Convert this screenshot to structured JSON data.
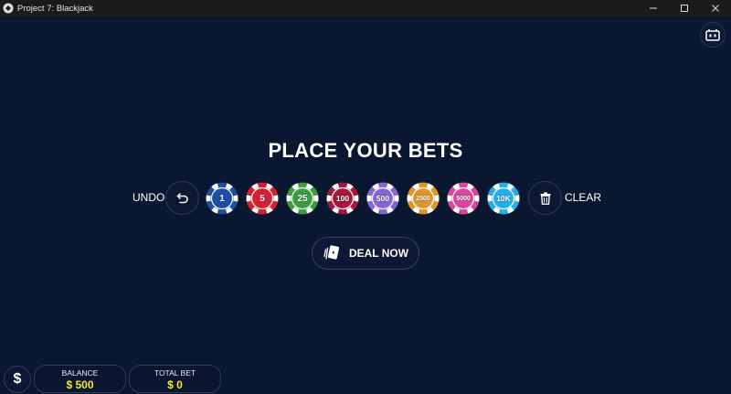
{
  "window": {
    "title": "Project 7: Blackjack",
    "minimize_icon": "minimize-icon",
    "maximize_icon": "maximize-icon",
    "close_icon": "close-icon"
  },
  "top_right_button": {
    "icon": "card-deck-icon"
  },
  "heading": "PLACE YOUR BETS",
  "undo": {
    "label": "UNDO",
    "icon": "undo-arrow-icon"
  },
  "clear": {
    "label": "CLEAR",
    "icon": "trash-icon"
  },
  "chips": [
    {
      "label": "1",
      "color": "#1e4fa3"
    },
    {
      "label": "5",
      "color": "#d42033"
    },
    {
      "label": "25",
      "color": "#3e9b3e"
    },
    {
      "label": "100",
      "color": "#a3193d"
    },
    {
      "label": "500",
      "color": "#8466d0"
    },
    {
      "label": "2500",
      "color": "#df962f"
    },
    {
      "label": "5000",
      "color": "#d6489e"
    },
    {
      "label": "10K",
      "color": "#27aee8"
    }
  ],
  "deal_button": {
    "label": "DEAL NOW",
    "icon": "cards-icon"
  },
  "bottom": {
    "dollar_icon": "dollar-icon",
    "dollar_symbol": "$",
    "balance_label": "BALANCE",
    "balance_value": "$ 500",
    "total_bet_label": "TOTAL BET",
    "total_bet_value": "$ 0"
  },
  "colors": {
    "background": "#0a1731",
    "value_yellow": "#f5e630"
  }
}
